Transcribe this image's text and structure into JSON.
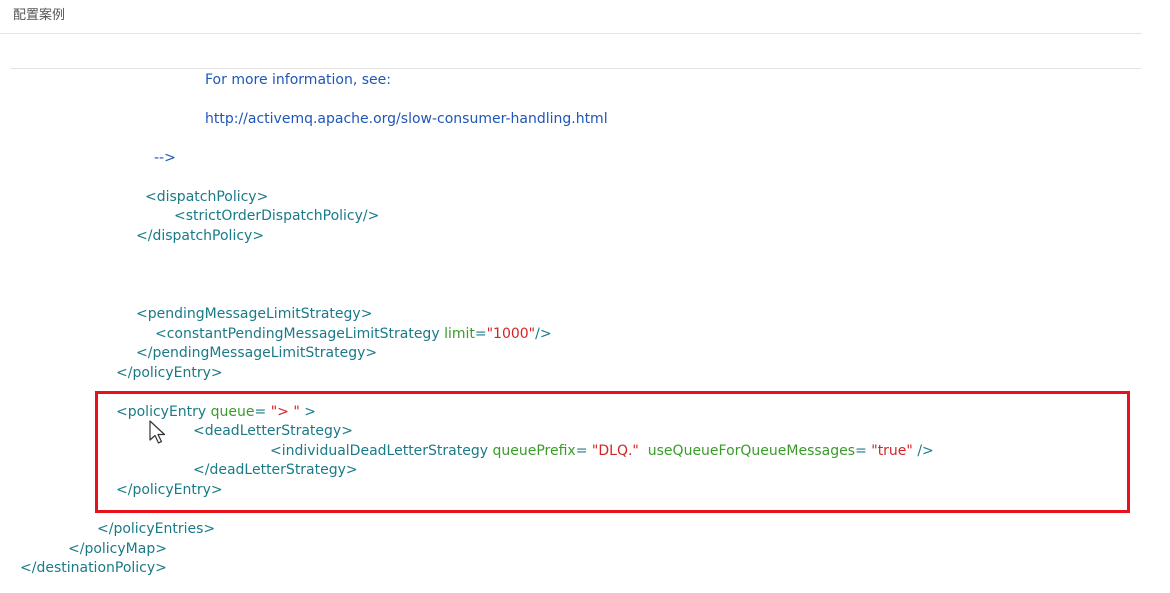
{
  "header": {
    "title": "配置案例"
  },
  "code": {
    "comment1": "For more information, see:",
    "comment2": "http://activemq.apache.org/slow-consumer-handling.html",
    "comment_end": "-->",
    "dispatch_open": "<dispatchPolicy>",
    "strict_order": "<strictOrderDispatchPolicy/>",
    "dispatch_close": "</dispatchPolicy>",
    "pending_open": "<pendingMessageLimitStrategy>",
    "constant_tag": "<constantPendingMessageLimitStrategy",
    "limit_attr": "limit",
    "limit_eq": "=",
    "limit_val": "\"1000\"",
    "constant_close": "/>",
    "pending_close": "</pendingMessageLimitStrategy>",
    "policy_entry_close1": "</policyEntry>",
    "policy_entry_open": "<policyEntry",
    "queue_attr": "queue",
    "queue_eq": "=",
    "queue_val": "\"> \"",
    "policy_entry_gt": ">",
    "dls_open": "<deadLetterStrategy>",
    "individual_tag": "<individualDeadLetterStrategy",
    "prefix_attr": "queuePrefix",
    "prefix_eq": "=",
    "prefix_val": "\"DLQ.\"",
    "useq_attr": "useQueueForQueueMessages",
    "useq_eq": "=",
    "useq_val": "\"true\"",
    "individual_close": "/>",
    "dls_close": "</deadLetterStrategy>",
    "policy_entry_close2": "</policyEntry>",
    "policy_entries_close": "</policyEntries>",
    "policy_map_close": "</policyMap>",
    "destination_policy_close": "</destinationPolicy>"
  },
  "colors": {
    "highlight_border": "#e8101a",
    "comment": "#1f56b8",
    "tag": "#1a7a88",
    "attribute": "#3a9a2a",
    "value": "#d32424"
  },
  "icons": {
    "cursor": "mouse-pointer-icon"
  }
}
